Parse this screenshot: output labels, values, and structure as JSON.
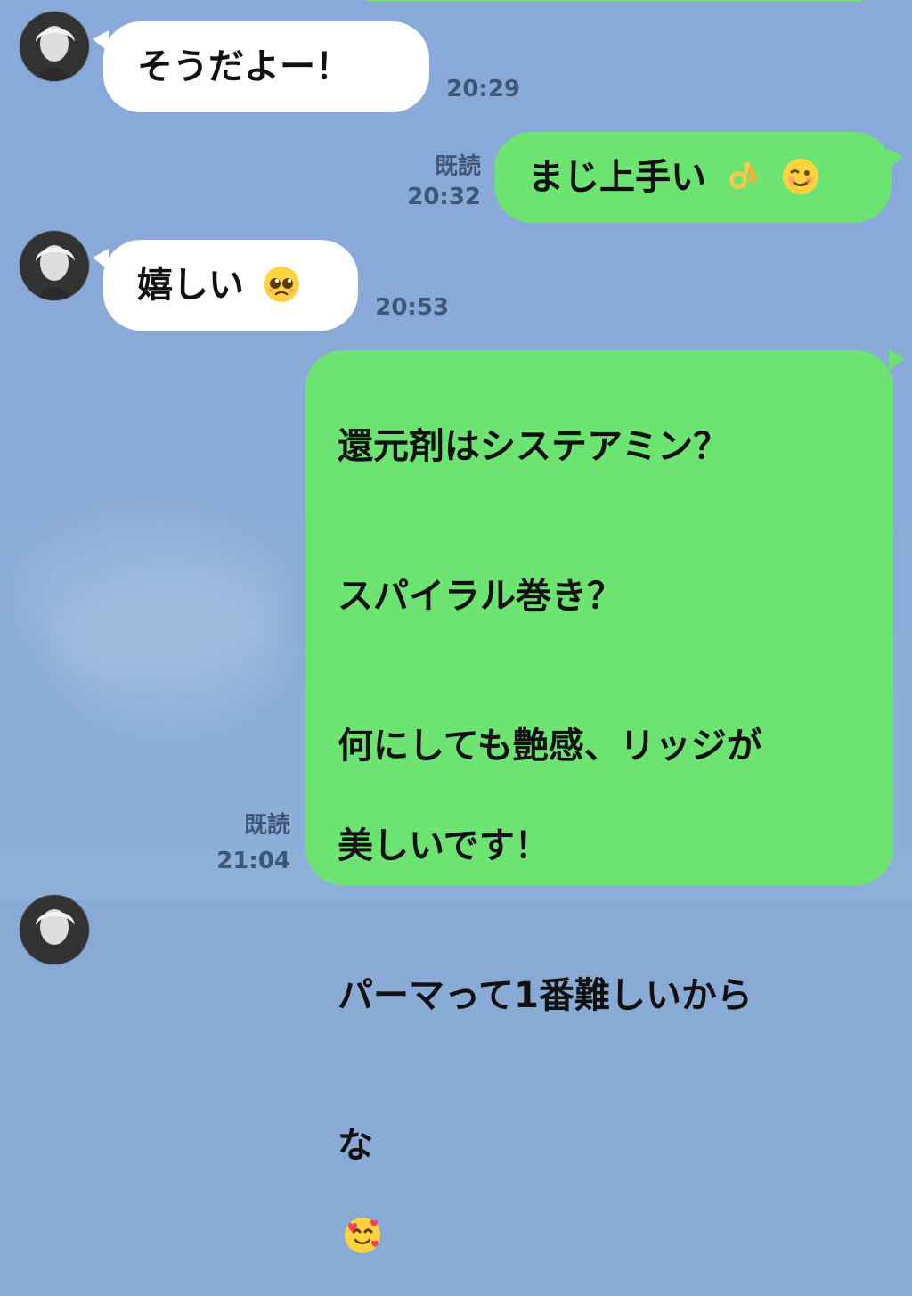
{
  "messages": [
    {
      "side": "in",
      "text": "そうだよー！",
      "time": "20:29",
      "emoji": []
    },
    {
      "side": "out",
      "text": "まじ上手い",
      "time": "20:32",
      "read": "既読",
      "emoji": [
        "ok-hand",
        "wink"
      ]
    },
    {
      "side": "in",
      "text": "嬉しい",
      "time": "20:53",
      "emoji": [
        "pleading"
      ]
    },
    {
      "side": "out",
      "lines": [
        "還元剤はシステアミン？",
        "",
        "スパイラル巻き？",
        "",
        "何にしても艶感、リッジが",
        "美しいです！",
        "",
        "パーマって1番難しいから",
        "な"
      ],
      "time": "21:04",
      "read": "既読",
      "emoji": [
        "smiling-with-hearts"
      ]
    }
  ],
  "colors": {
    "background": "#8aaad6",
    "incoming_bubble": "#ffffff",
    "outgoing_bubble": "#6de372",
    "timestamp": "#3f5676",
    "text": "#111111"
  }
}
